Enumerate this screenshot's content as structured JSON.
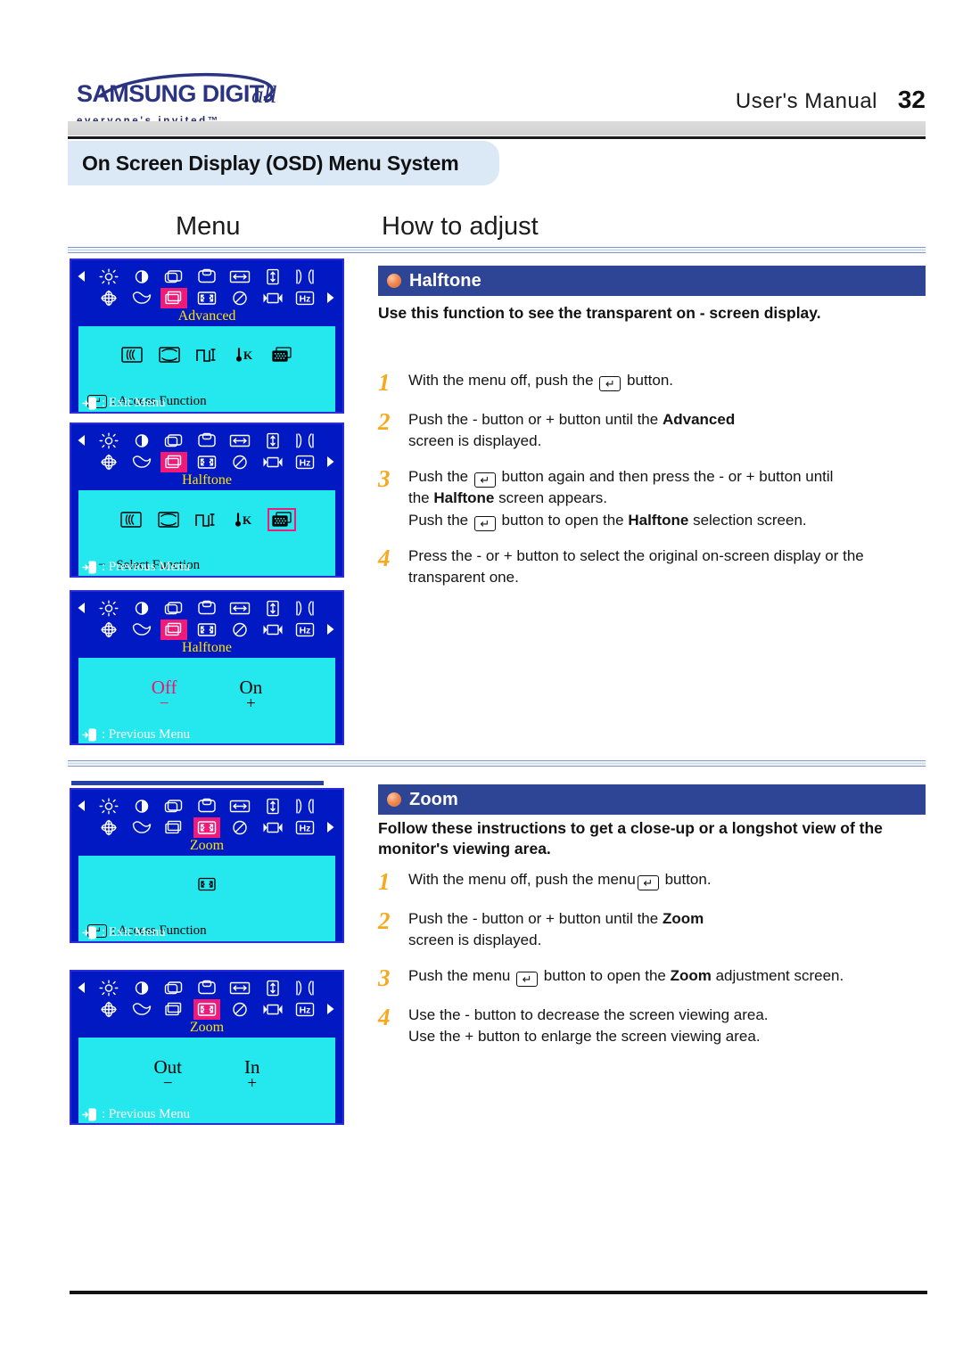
{
  "header": {
    "brand_main": "SAMSUNG DIGIT",
    "brand_italic": "all",
    "brand_tagline": "everyone's invited™",
    "manual_label": "User's  Manual",
    "page_number": "32"
  },
  "section_title": "On Screen Display (OSD) Menu System",
  "columns": {
    "left": "Menu",
    "right": "How to adjust"
  },
  "colors": {
    "osd_background": "#0019c2",
    "osd_body": "#25e8ee",
    "osd_selected": "#ef1a7a",
    "osd_title": "#ffe400",
    "section_header": "#2e4494",
    "step_number": "#f6a81e",
    "title_band": "#dbe9f7",
    "bullet": "#f08a55"
  },
  "osd_panels": [
    {
      "id": "halftone-advanced",
      "selected_index": 2,
      "title": "Advanced",
      "subicons": [
        "moire-icon",
        "pincushion-balance-icon",
        "signal-level-icon",
        "color-temperature-icon",
        "halftone-icon"
      ],
      "subicon_selected": -1,
      "hint_key": "enter-icon",
      "hint": ": Access Function",
      "footer_key": "exit-icon",
      "footer": ": Exit Menu"
    },
    {
      "id": "halftone-select",
      "selected_index": 2,
      "title": "Halftone",
      "subicons": [
        "moire-icon",
        "pincushion-balance-icon",
        "signal-level-icon",
        "color-temperature-icon",
        "halftone-icon"
      ],
      "subicon_selected": 4,
      "hint_key": "plusminus",
      "hint": "+ − : Select Function",
      "footer_key": "exit-icon",
      "footer": ": Previous Menu"
    },
    {
      "id": "halftone-onoff",
      "selected_index": 2,
      "title": "Halftone",
      "options": [
        {
          "label": "Off",
          "sign": "−",
          "highlighted": true
        },
        {
          "label": "On",
          "sign": "+",
          "highlighted": false
        }
      ],
      "footer_key": "exit-icon",
      "footer": ": Previous Menu"
    },
    {
      "id": "zoom-access",
      "selected_index": 3,
      "title": "Zoom",
      "subicons": [
        "zoom-icon"
      ],
      "subicon_selected": -1,
      "hint_key": "enter-icon",
      "hint": ": Access Function",
      "footer_key": "exit-icon",
      "footer": ": Exit Menu"
    },
    {
      "id": "zoom-adjust",
      "selected_index": 3,
      "title": "Zoom",
      "options": [
        {
          "label": "Out",
          "sign": "−",
          "highlighted": false
        },
        {
          "label": "In",
          "sign": "+",
          "highlighted": false
        }
      ],
      "footer_key": "exit-icon",
      "footer": ": Previous Menu"
    }
  ],
  "sections": [
    {
      "id": "halftone",
      "heading": "Halftone",
      "description": "Use this function to see the transparent on - screen display.",
      "steps": [
        {
          "num": "1",
          "parts": [
            {
              "t": "text",
              "v": "With the menu off, push the "
            },
            {
              "t": "key",
              "v": "↵"
            },
            {
              "t": "text",
              "v": " button."
            }
          ]
        },
        {
          "num": "2",
          "parts": [
            {
              "t": "text",
              "v": "Push the - button or  + button until the "
            },
            {
              "t": "bold",
              "v": "Advanced"
            },
            {
              "t": "br"
            },
            {
              "t": "text",
              "v": "screen is displayed."
            }
          ]
        },
        {
          "num": "3",
          "parts": [
            {
              "t": "text",
              "v": "Push the "
            },
            {
              "t": "key",
              "v": "↵"
            },
            {
              "t": "text",
              "v": " button again and then press the - or + button until"
            },
            {
              "t": "br"
            },
            {
              "t": "text",
              "v": "the "
            },
            {
              "t": "bold",
              "v": "Halftone"
            },
            {
              "t": "text",
              "v": " screen appears."
            },
            {
              "t": "br"
            },
            {
              "t": "text",
              "v": "Push the "
            },
            {
              "t": "key",
              "v": "↵"
            },
            {
              "t": "text",
              "v": " button to open the "
            },
            {
              "t": "bold",
              "v": "Halftone"
            },
            {
              "t": "text",
              "v": " selection screen."
            }
          ]
        },
        {
          "num": "4",
          "parts": [
            {
              "t": "text",
              "v": "Press the - or + button to select the original on-screen display or the"
            },
            {
              "t": "br"
            },
            {
              "t": "text",
              "v": "transparent one."
            }
          ]
        }
      ]
    },
    {
      "id": "zoom",
      "heading": "Zoom",
      "description": "Follow these instructions to get a close-up or a longshot view of the monitor's viewing area.",
      "steps": [
        {
          "num": "1",
          "parts": [
            {
              "t": "text",
              "v": "With the menu off, push the menu"
            },
            {
              "t": "key",
              "v": "↵"
            },
            {
              "t": "text",
              "v": " button."
            }
          ]
        },
        {
          "num": "2",
          "parts": [
            {
              "t": "text",
              "v": "Push the  - button or  + button until the "
            },
            {
              "t": "bold",
              "v": "Zoom"
            },
            {
              "t": "br"
            },
            {
              "t": "text",
              "v": "screen is displayed."
            }
          ]
        },
        {
          "num": "3",
          "parts": [
            {
              "t": "text",
              "v": "Push the menu "
            },
            {
              "t": "key",
              "v": "↵"
            },
            {
              "t": "text",
              "v": " button to open the "
            },
            {
              "t": "bold",
              "v": "Zoom"
            },
            {
              "t": "text",
              "v": " adjustment screen."
            }
          ]
        },
        {
          "num": "4",
          "parts": [
            {
              "t": "text",
              "v": "Use the  - button to decrease the screen viewing area."
            },
            {
              "t": "br"
            },
            {
              "t": "text",
              "v": "Use the  + button to enlarge the screen viewing area."
            }
          ]
        }
      ]
    }
  ],
  "osd_top_icons": {
    "row1": [
      "brightness-icon",
      "contrast-icon",
      "h-position-icon",
      "v-position-icon",
      "h-size-icon",
      "v-size-icon",
      "pincushion-icon"
    ],
    "row2": [
      "rotation-icon",
      "trapezoid-icon",
      "advanced-icon",
      "zoom-icon",
      "degauss-icon",
      "osd-position-icon",
      "frequency-hz-icon"
    ],
    "left_arrow": "arrow-left-icon",
    "right_arrow": "arrow-right-icon"
  }
}
